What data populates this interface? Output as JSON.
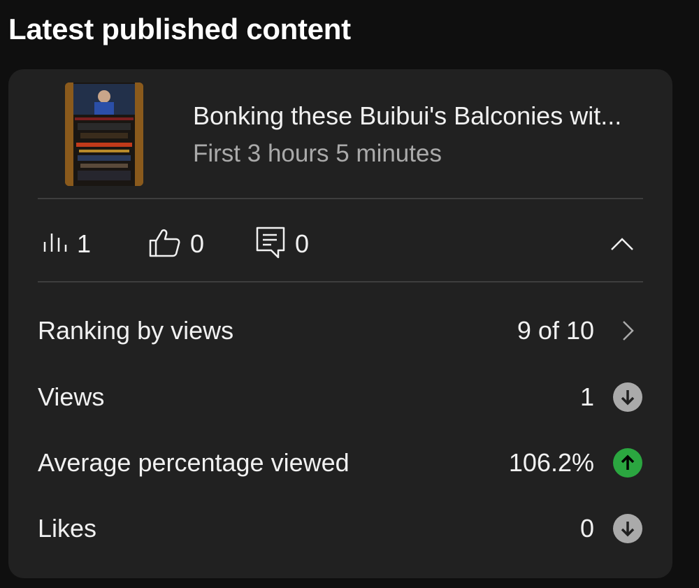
{
  "section": {
    "title": "Latest published content"
  },
  "video": {
    "title": "Bonking these Buibui's Balconies wit...",
    "subtitle": "First 3 hours 5 minutes"
  },
  "stats": {
    "views": "1",
    "likes": "0",
    "comments": "0"
  },
  "metrics": [
    {
      "label": "Ranking by views",
      "value": "9 of 10",
      "indicator": "chevron-right-icon"
    },
    {
      "label": "Views",
      "value": "1",
      "indicator": "arrow-down-icon",
      "trend": "down",
      "color": "#aaaaaa"
    },
    {
      "label": "Average percentage viewed",
      "value": "106.2%",
      "indicator": "arrow-up-icon",
      "trend": "up",
      "color": "#2ba640"
    },
    {
      "label": "Likes",
      "value": "0",
      "indicator": "arrow-down-icon",
      "trend": "down",
      "color": "#aaaaaa"
    }
  ],
  "colors": {
    "background": "#0f0f0f",
    "card": "#212121",
    "trend_up": "#2ba640",
    "trend_neutral": "#aaaaaa"
  }
}
